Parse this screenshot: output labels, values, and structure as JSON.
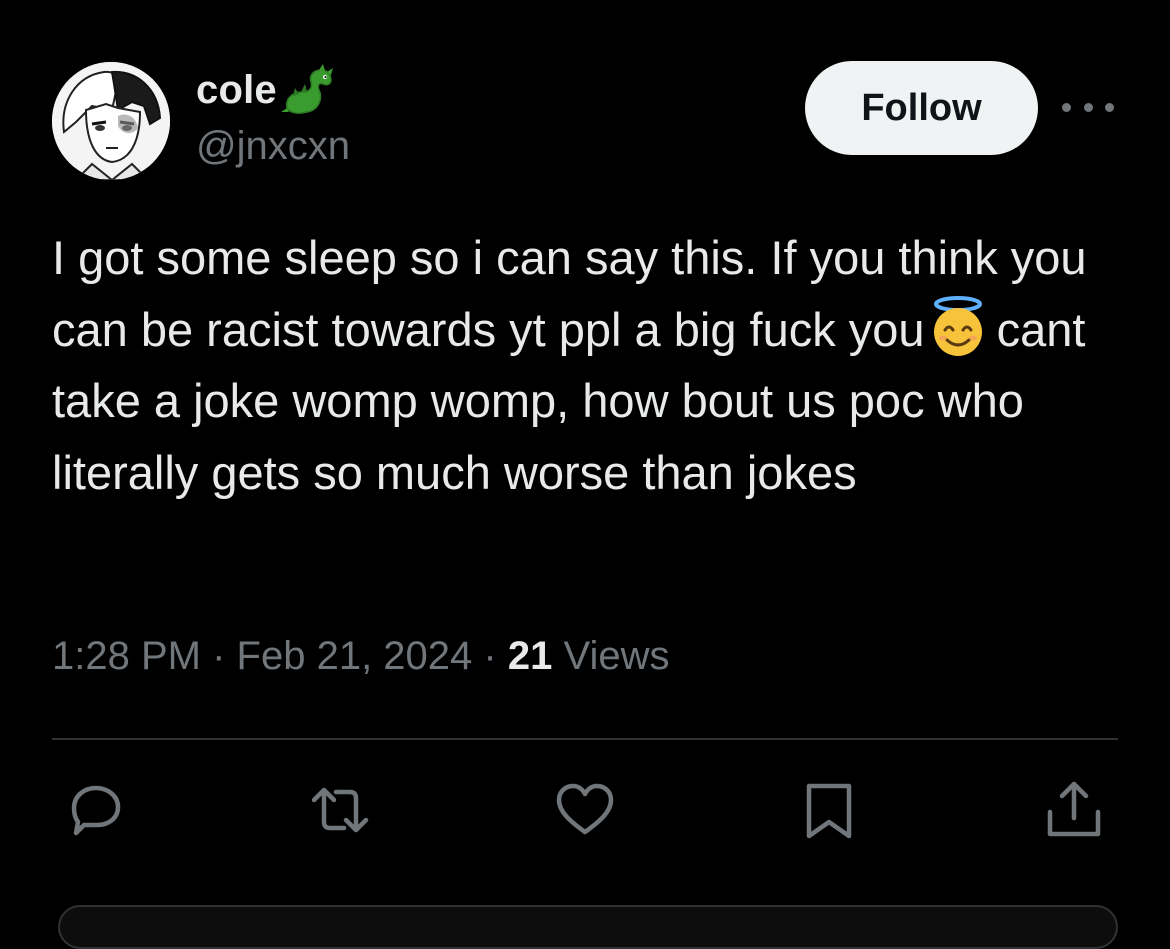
{
  "colors": {
    "background": "#000000",
    "primary_text": "#e7e9ea",
    "secondary_text": "#71767b",
    "follow_bg": "#eff3f4",
    "follow_text": "#0f1419",
    "divider": "#2f3336"
  },
  "author": {
    "display_name": "cole",
    "name_emoji": "dragon",
    "handle": "@jnxcxn",
    "avatar": "anime-character-avatar"
  },
  "follow_label": "Follow",
  "more_icon": "more-horizontal-icon",
  "tweet": {
    "text_before_emoji": "I got some sleep so i can say this. If you think you can be racist towards yt ppl a big fuck you",
    "emoji": "smiling-face-with-halo",
    "text_after_emoji": "cant take a joke womp womp, how bout us poc who literally gets so much worse than jokes"
  },
  "meta": {
    "time": "1:28 PM",
    "separator": "·",
    "date": "Feb 21, 2024",
    "views_count": "21",
    "views_label": "Views"
  },
  "actions": [
    {
      "name": "reply",
      "icon": "reply-icon"
    },
    {
      "name": "retweet",
      "icon": "retweet-icon"
    },
    {
      "name": "like",
      "icon": "heart-icon"
    },
    {
      "name": "bookmark",
      "icon": "bookmark-icon"
    },
    {
      "name": "share",
      "icon": "share-icon"
    }
  ]
}
